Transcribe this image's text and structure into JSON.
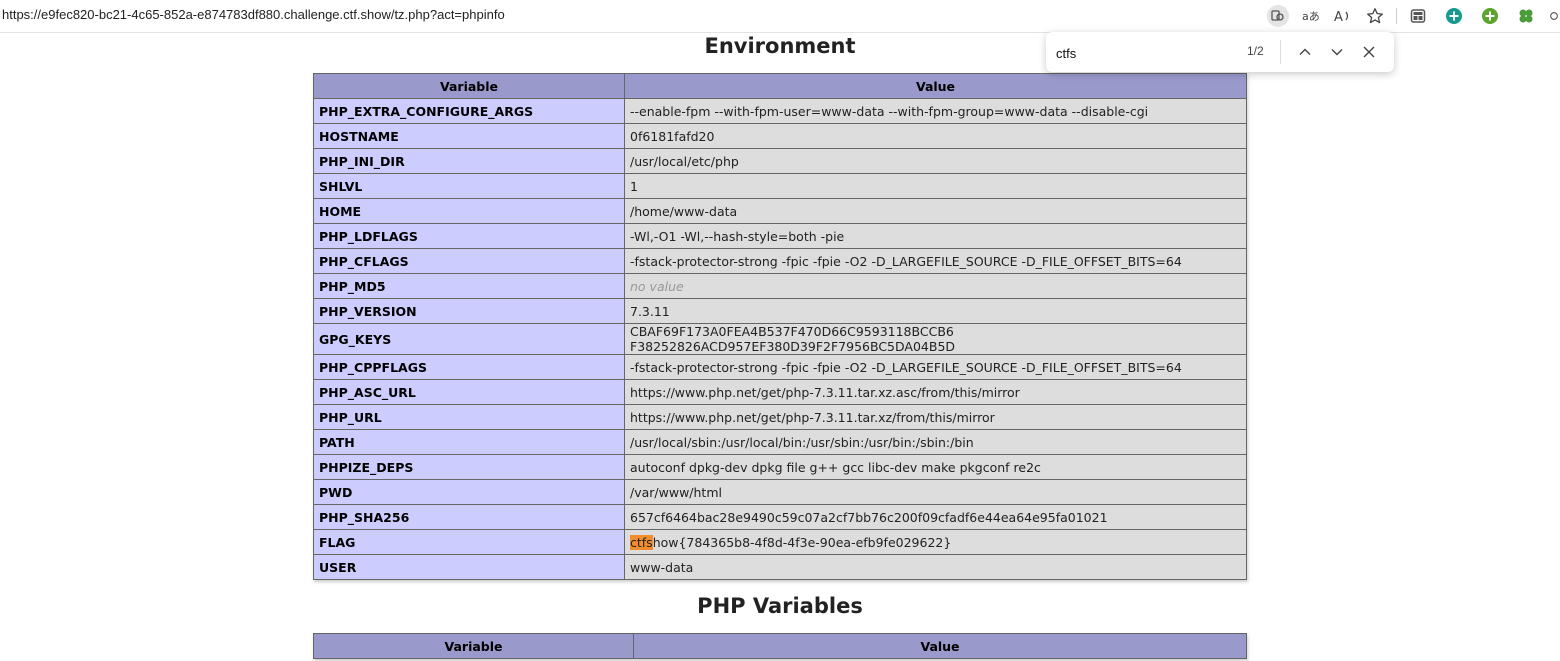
{
  "browser": {
    "url": "https://e9fec820-bc21-4c65-852a-e874783df880.challenge.ctf.show/tz.php?act=phpinfo"
  },
  "findbar": {
    "query": "ctfs",
    "count": "1/2"
  },
  "environment": {
    "heading": "Environment",
    "columns": [
      "Variable",
      "Value"
    ],
    "rows": [
      {
        "name": "PHP_EXTRA_CONFIGURE_ARGS",
        "value": "--enable-fpm --with-fpm-user=www-data --with-fpm-group=www-data --disable-cgi"
      },
      {
        "name": "HOSTNAME",
        "value": "0f6181fafd20"
      },
      {
        "name": "PHP_INI_DIR",
        "value": "/usr/local/etc/php"
      },
      {
        "name": "SHLVL",
        "value": "1"
      },
      {
        "name": "HOME",
        "value": "/home/www-data"
      },
      {
        "name": "PHP_LDFLAGS",
        "value": "-Wl,-O1 -Wl,--hash-style=both -pie"
      },
      {
        "name": "PHP_CFLAGS",
        "value": "-fstack-protector-strong -fpic -fpie -O2 -D_LARGEFILE_SOURCE -D_FILE_OFFSET_BITS=64"
      },
      {
        "name": "PHP_MD5",
        "value": "no value"
      },
      {
        "name": "PHP_VERSION",
        "value": "7.3.11"
      },
      {
        "name": "GPG_KEYS",
        "value": "CBAF69F173A0FEA4B537F470D66C9593118BCCB6 F38252826ACD957EF380D39F2F7956BC5DA04B5D"
      },
      {
        "name": "PHP_CPPFLAGS",
        "value": "-fstack-protector-strong -fpic -fpie -O2 -D_LARGEFILE_SOURCE -D_FILE_OFFSET_BITS=64"
      },
      {
        "name": "PHP_ASC_URL",
        "value": "https://www.php.net/get/php-7.3.11.tar.xz.asc/from/this/mirror"
      },
      {
        "name": "PHP_URL",
        "value": "https://www.php.net/get/php-7.3.11.tar.xz/from/this/mirror"
      },
      {
        "name": "PATH",
        "value": "/usr/local/sbin:/usr/local/bin:/usr/sbin:/usr/bin:/sbin:/bin"
      },
      {
        "name": "PHPIZE_DEPS",
        "value": "autoconf dpkg-dev dpkg file g++ gcc libc-dev make pkgconf re2c"
      },
      {
        "name": "PWD",
        "value": "/var/www/html"
      },
      {
        "name": "PHP_SHA256",
        "value": "657cf6464bac28e9490c59c07a2cf7bb76c200f09cfadf6e44ea64e95fa01021"
      },
      {
        "name": "FLAG",
        "value_highlight": "ctfs",
        "value_rest": "how{784365b8-4f8d-4f3e-90ea-efb9fe029622}"
      },
      {
        "name": "USER",
        "value": "www-data"
      }
    ]
  },
  "php_variables": {
    "heading": "PHP Variables",
    "columns": [
      "Variable",
      "Value"
    ]
  },
  "colors": {
    "header_bg": "#9999cc",
    "name_bg": "#ccccff",
    "value_bg": "#dddddd",
    "find_highlight": "#f68d2c"
  },
  "icons": [
    "translate-icon",
    "read-aloud-icon",
    "read-mode-icon",
    "favorite-star-icon",
    "collections-icon",
    "edge-extension-teal-icon",
    "edge-extension-green-icon",
    "clover-extension-icon",
    "find-prev-icon",
    "find-next-icon",
    "close-icon"
  ]
}
